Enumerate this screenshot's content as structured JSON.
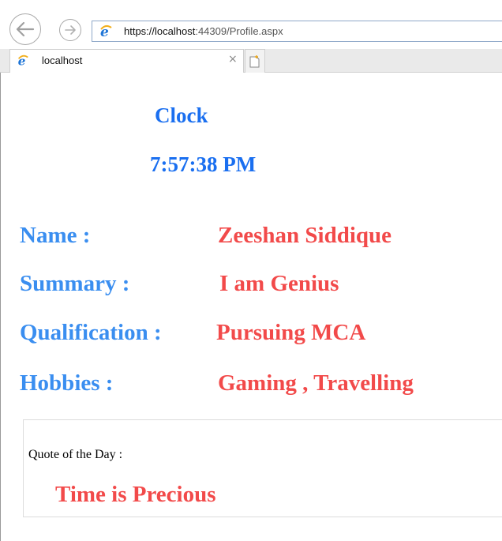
{
  "browser": {
    "url_prefix": "https://localhost",
    "url_rest": ":44309/Profile.aspx",
    "tab_title": "localhost",
    "tab_close": "×"
  },
  "clock": {
    "label": "Clock",
    "time": "7:57:38 PM"
  },
  "profile": {
    "rows": [
      {
        "label": "Name :",
        "value": "Zeeshan Siddique"
      },
      {
        "label": "Summary :",
        "value": "I am Genius"
      },
      {
        "label": "Qualification :",
        "value": "Pursuing MCA"
      },
      {
        "label": "Hobbies :",
        "value": "Gaming , Travelling"
      }
    ]
  },
  "quote": {
    "label": "Quote of the Day :",
    "text": "Time is Precious"
  },
  "colors": {
    "label_blue": "#3a8ef0",
    "clock_blue": "#1a6ff0",
    "value_red": "#f24a4a",
    "ie_blue": "#1d74d6"
  }
}
